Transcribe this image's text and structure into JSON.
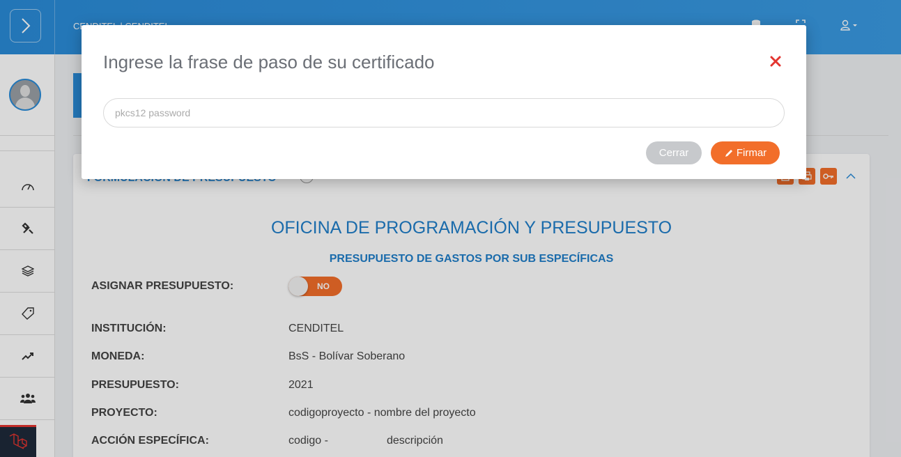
{
  "topbar": {
    "org": "CENDITEL | CENDITEL"
  },
  "sidebar": {
    "items": [
      {
        "icon": "dashboard-icon"
      },
      {
        "icon": "tools-icon"
      },
      {
        "icon": "layers-icon"
      },
      {
        "icon": "tag-icon"
      },
      {
        "icon": "trend-icon"
      },
      {
        "icon": "users-icon"
      }
    ]
  },
  "card": {
    "title": "FORMULACIÓN DE PRESUPUESTO",
    "office": "OFICINA DE PROGRAMACIÓN Y PRESUPUESTO",
    "subtitle": "PRESUPUESTO DE GASTOS POR SUB ESPECÍFICAS",
    "assign_label": "ASIGNAR PRESUPUESTO:",
    "assign_switch": "NO",
    "fields": [
      {
        "label": "INSTITUCIÓN:",
        "value": "CENDITEL"
      },
      {
        "label": "MONEDA:",
        "value": "BsS - Bolívar Soberano"
      },
      {
        "label": "PRESUPUESTO:",
        "value": "2021"
      },
      {
        "label": "PROYECTO:",
        "value": "codigoproyecto - nombre del proyecto"
      },
      {
        "label": "ACCIÓN ESPECÍFICA:",
        "value_code": "codigo -",
        "value_desc": "descripción"
      }
    ]
  },
  "modal": {
    "title": "Ingrese la frase de paso de su certificado",
    "input_placeholder": "pkcs12 password",
    "input_value": "",
    "cancel_label": "Cerrar",
    "sign_label": "Firmar",
    "accent": "#f26e2a",
    "close_color": "#e3342f"
  }
}
